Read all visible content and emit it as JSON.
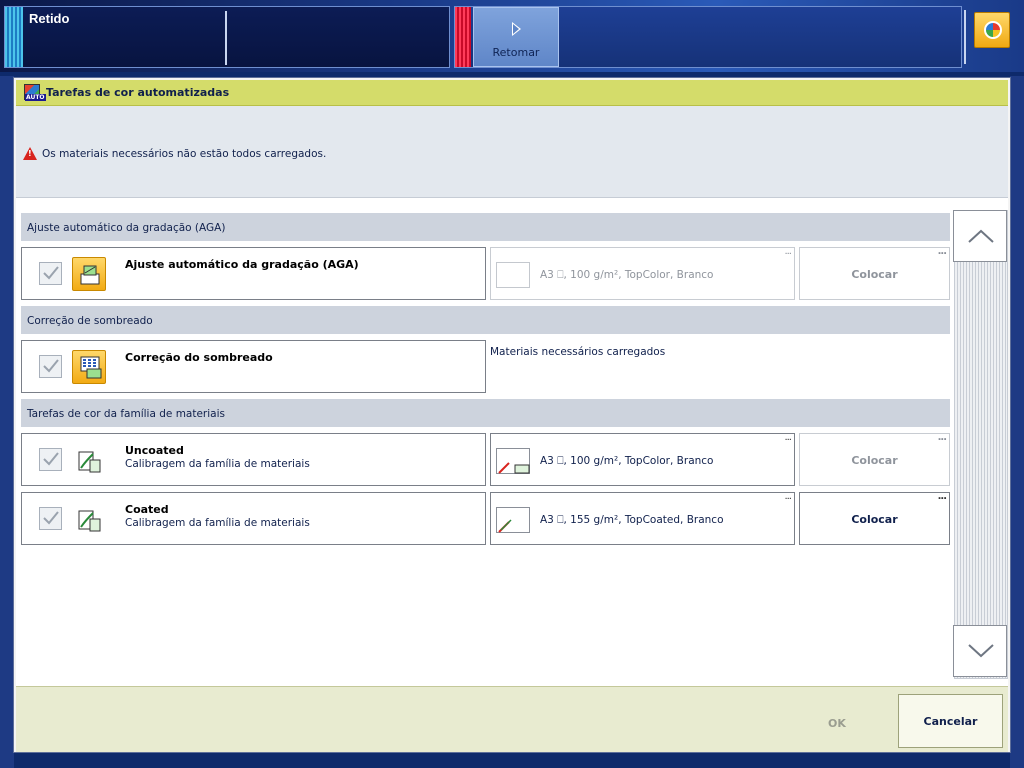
{
  "topbar": {
    "status_title": "Retido",
    "resume_label": "Retomar",
    "color_button_icon": "color-wheel-icon"
  },
  "dialog": {
    "title": "Tarefas de cor automatizadas",
    "title_icon": "auto-color-icon",
    "warning_icon": "warning-icon",
    "warning_text": "Os materiais necessários não estão todos carregados.",
    "colors": {
      "header_bg": "#d4dc6a",
      "message_bg": "#e3e8ee",
      "section_bg": "#cdd3dd",
      "footer_bg": "#e8ebd0",
      "warning": "#d8241e"
    },
    "sections": [
      {
        "header": "Ajuste automático da gradação (AGA)",
        "tasks": [
          {
            "title": "Ajuste automático da gradação (AGA)",
            "subtitle": "",
            "checked": true,
            "icon": "printer-gradation-icon",
            "media": "A3 ⎕, 100 g/m², TopColor, Branco",
            "media_dots": "...",
            "place": "Colocar",
            "place_enabled": false
          }
        ]
      },
      {
        "header": "Correção de sombreado",
        "tasks": [
          {
            "title": "Correção do sombreado",
            "subtitle": "",
            "checked": true,
            "icon": "printer-shading-icon",
            "loaded_note": "Materiais necessários carregados"
          }
        ]
      },
      {
        "header": "Tarefas de cor da família de materiais",
        "tasks": [
          {
            "title": "Uncoated",
            "subtitle": "Calibragem da família de materiais",
            "checked": true,
            "icon": "media-family-calibration-icon",
            "media": "A3 ⎕, 100 g/m², TopColor, Branco",
            "media_dots": "...",
            "place": "Colocar",
            "place_enabled": false
          },
          {
            "title": "Coated",
            "subtitle": "Calibragem da família de materiais",
            "checked": true,
            "icon": "media-family-calibration-icon",
            "media": "A3 ⎕, 155 g/m², TopCoated, Branco",
            "media_dots": "...",
            "place": "Colocar",
            "place_enabled": true
          }
        ]
      }
    ],
    "scroll": {
      "up_icon": "chevron-up-icon",
      "down_icon": "chevron-down-icon"
    },
    "footer": {
      "ok_label": "OK",
      "cancel_label": "Cancelar"
    }
  }
}
